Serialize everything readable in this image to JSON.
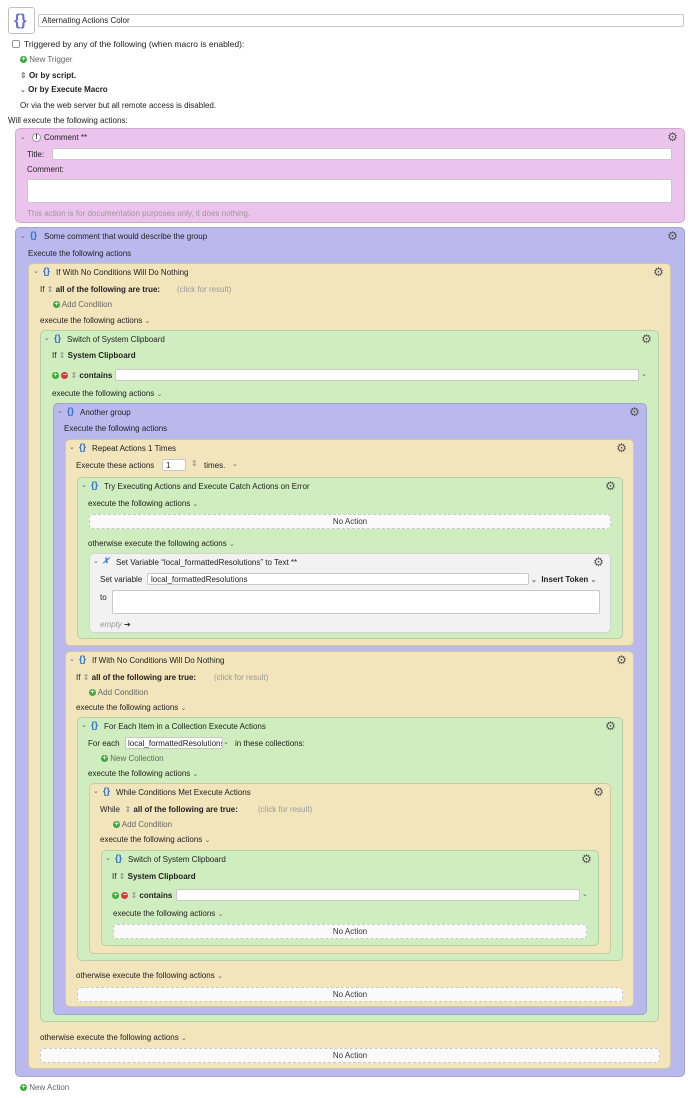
{
  "macro": {
    "name": "Alternating Actions Color",
    "triggered_label": "Triggered by any of the following (when macro is enabled):",
    "new_trigger": "New Trigger",
    "or_script": "Or by script.",
    "or_execute": "Or by Execute Macro",
    "web_server": "Or via the web server but all remote access is disabled.",
    "will_execute": "Will execute the following actions:",
    "new_action": "New Action"
  },
  "comment": {
    "header": "Comment **",
    "title_label": "Title:",
    "comment_label": "Comment:",
    "footer": "This action is for documentation purposes only, it does nothing."
  },
  "group1": {
    "header": "Some comment that would describe the group",
    "execute": "Execute the following actions"
  },
  "if1": {
    "header": "If With No Conditions Will Do Nothing",
    "if_label": "If",
    "all_true": "all of the following are true:",
    "click": "(click for result)",
    "add_condition": "Add Condition",
    "execute": "execute the following actions",
    "otherwise": "otherwise execute the following actions",
    "no_action": "No Action"
  },
  "switch1": {
    "header": "Switch of System Clipboard",
    "if_label": "If",
    "source": "System Clipboard",
    "contains": "contains",
    "execute": "execute the following actions"
  },
  "group2": {
    "header": "Another group",
    "execute": "Execute the following actions"
  },
  "repeat": {
    "header": "Repeat Actions 1 Times",
    "execute_these": "Execute these actions",
    "count": "1",
    "times": "times."
  },
  "try": {
    "header": "Try Executing Actions and Execute Catch Actions on Error",
    "execute": "execute the following actions",
    "no_action": "No Action",
    "otherwise": "otherwise execute the following actions"
  },
  "setvar": {
    "header": "Set Variable “local_formattedResolutions” to Text **",
    "set_label": "Set variable",
    "var_name": "local_formattedResolutions",
    "insert_token": "Insert Token",
    "to_label": "to",
    "empty": "empty"
  },
  "if2": {
    "header": "If With No Conditions Will Do Nothing",
    "if_label": "If",
    "all_true": "all of the following are true:",
    "click": "(click for result)",
    "add_condition": "Add Condition",
    "execute": "execute the following actions",
    "otherwise": "otherwise execute the following actions",
    "no_action": "No Action"
  },
  "foreach": {
    "header": "For Each Item in a Collection Execute Actions",
    "for_each": "For each",
    "var": "local_formattedResolutions",
    "in_collections": "in these collections:",
    "new_collection": "New Collection",
    "execute": "execute the following actions"
  },
  "while": {
    "header": "While Conditions Met Execute Actions",
    "while_label": "While",
    "all_true": "all of the following are true:",
    "click": "(click for result)",
    "add_condition": "Add Condition",
    "execute": "execute the following actions"
  },
  "switch2": {
    "header": "Switch of System Clipboard",
    "if_label": "If",
    "source": "System Clipboard",
    "contains": "contains",
    "execute": "execute the following actions",
    "no_action": "No Action"
  },
  "colors": {
    "comment": "#ecc3ec",
    "group": "#b9b9ee",
    "if": "#f2e4bb",
    "switch": "#cfedbe"
  }
}
